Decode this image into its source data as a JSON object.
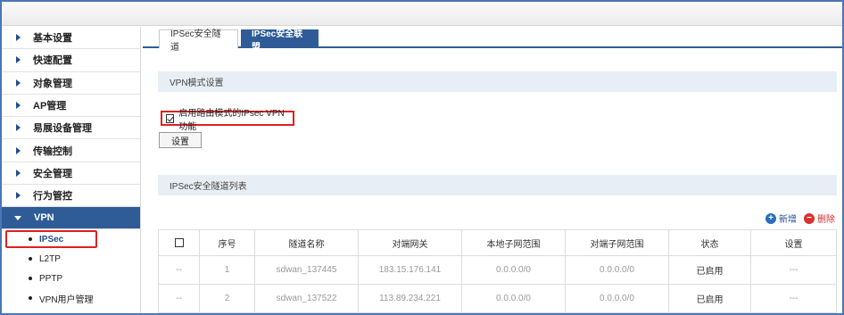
{
  "sidebar": {
    "items": [
      {
        "label": "基本设置"
      },
      {
        "label": "快速配置"
      },
      {
        "label": "对象管理"
      },
      {
        "label": "AP管理"
      },
      {
        "label": "易展设备管理"
      },
      {
        "label": "传输控制"
      },
      {
        "label": "安全管理"
      },
      {
        "label": "行为管控"
      },
      {
        "label": "VPN"
      }
    ],
    "sub_items": [
      {
        "label": "IPSec"
      },
      {
        "label": "L2TP"
      },
      {
        "label": "PPTP"
      },
      {
        "label": "VPN用户管理"
      }
    ]
  },
  "tabs": [
    {
      "label": "IPSec安全隧道"
    },
    {
      "label": "IPSec安全联盟"
    }
  ],
  "vpn_mode": {
    "section_title": "VPN模式设置",
    "checkbox_label": "启用路由模式的IPsec VPN功能",
    "checked": true,
    "button_label": "设置"
  },
  "tunnel_list": {
    "section_title": "IPSec安全隧道列表",
    "add_label": "新增",
    "delete_label": "删除",
    "columns": [
      "序号",
      "隧道名称",
      "对端网关",
      "本地子网范围",
      "对端子网范围",
      "状态",
      "设置"
    ],
    "rows": [
      {
        "check": "--",
        "no": "1",
        "name": "sdwan_137445",
        "gateway": "183.15.176.141",
        "local": "0.0.0.0/0",
        "peer": "0.0.0.0/0",
        "status": "已启用",
        "setting": "---"
      },
      {
        "check": "--",
        "no": "2",
        "name": "sdwan_137522",
        "gateway": "113.89.234.221",
        "local": "0.0.0.0/0",
        "peer": "0.0.0.0/0",
        "status": "已启用",
        "setting": "---"
      }
    ]
  },
  "colors": {
    "accent": "#2f5c97",
    "highlight": "#e02020",
    "section_bg": "#e8eef5"
  },
  "icons": {
    "menu_arrow": "caret-right-icon",
    "add": "plus-circle-icon",
    "delete": "minus-circle-icon"
  }
}
